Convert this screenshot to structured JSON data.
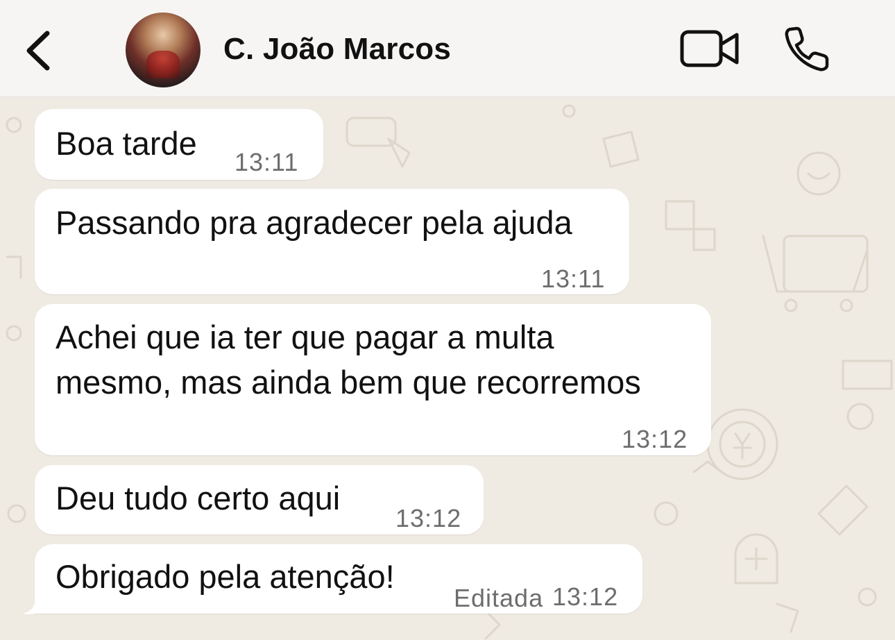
{
  "header": {
    "contact_name": "C. João Marcos"
  },
  "icons": {
    "back": "chevron-left-icon",
    "video": "video-camera-icon",
    "phone": "phone-icon"
  },
  "messages": [
    {
      "text": "Boa tarde",
      "time": "13:11"
    },
    {
      "text": "Passando pra agradecer pela ajuda",
      "time": "13:11"
    },
    {
      "text_line1": "Achei que ia ter que pagar a multa",
      "text_line2": "mesmo, mas ainda bem que recorremos",
      "time": "13:12"
    },
    {
      "text": "Deu tudo certo aqui",
      "time": "13:12"
    },
    {
      "text": "Obrigado pela atenção!",
      "edited_label": "Editada",
      "time": "13:12"
    }
  ],
  "colors": {
    "wallpaper": "#efeae2",
    "bubble": "#ffffff",
    "timestamp": "#6d6d6d",
    "header": "#f6f5f3"
  }
}
